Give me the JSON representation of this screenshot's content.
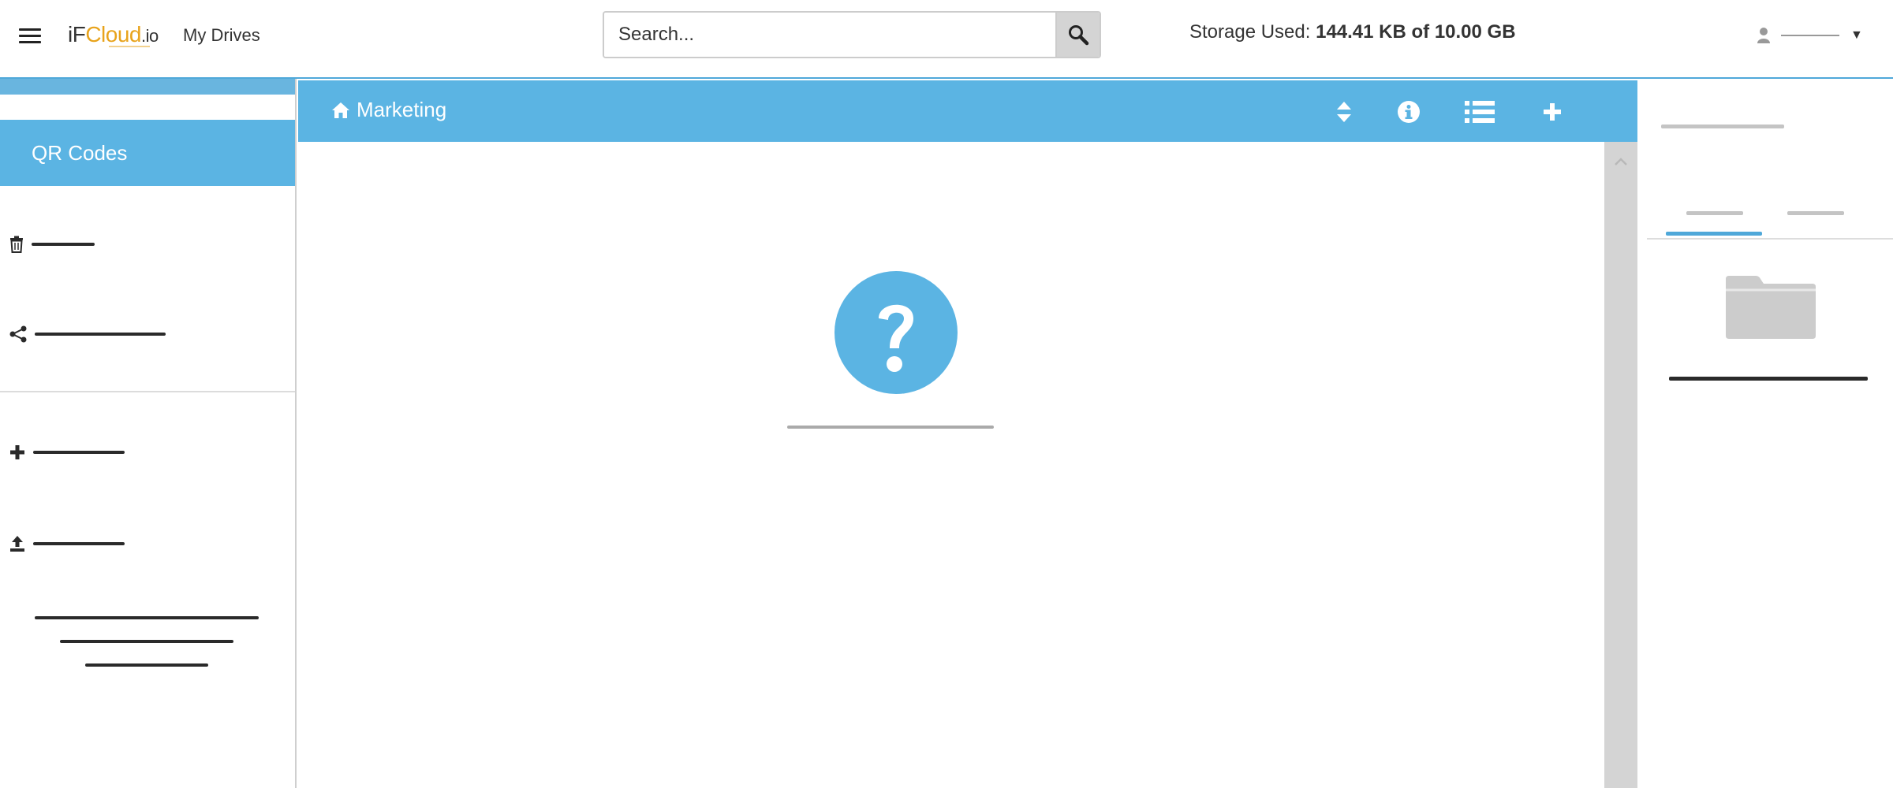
{
  "header": {
    "logo": {
      "part1": "iF",
      "part2": "Cloud",
      "part3": ".io"
    },
    "nav_link": "My Drives",
    "search": {
      "placeholder": "Search..."
    },
    "storage": {
      "label": "Storage Used:",
      "value": "144.41 KB of 10.00 GB"
    },
    "user": {
      "icon": "user-icon",
      "caret": "▼"
    }
  },
  "sidebar": {
    "active_item": "QR Codes",
    "icons": [
      "trash-icon",
      "share-icon",
      "plus-icon",
      "upload-icon"
    ]
  },
  "main": {
    "breadcrumb": "Marketing",
    "toolbar_icons": [
      "sort-icon",
      "info-icon",
      "list-icon",
      "plus-icon"
    ],
    "empty_state_icon": "question-icon"
  },
  "right_panel": {
    "icons": [
      "folder-icon"
    ]
  },
  "colors": {
    "accent": "#5bb4e3",
    "brand_orange": "#e8a31b",
    "scrollbar": "#d4d4d4"
  }
}
